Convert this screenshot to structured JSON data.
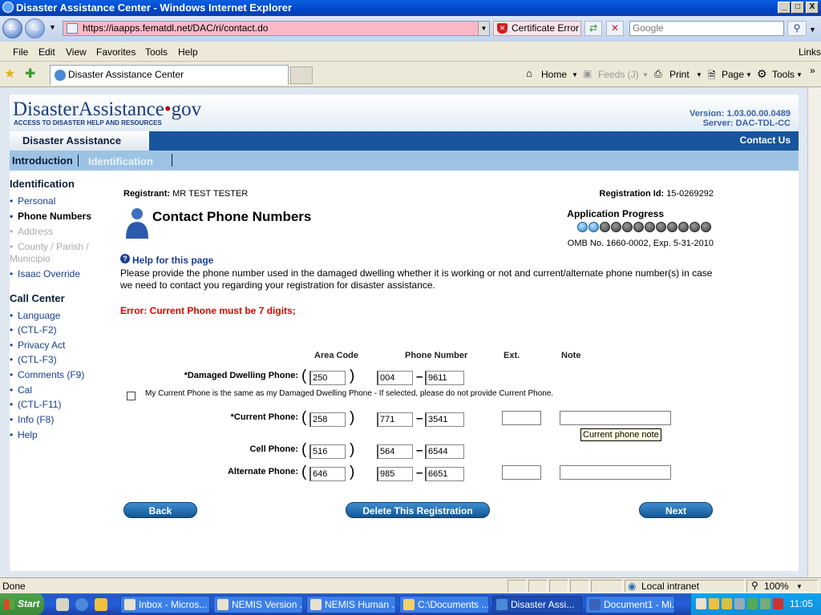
{
  "window": {
    "title": "Disaster Assistance Center - Windows Internet Explorer"
  },
  "toolbar": {
    "url": "https://iaapps.fematdl.net/DAC/ri/contact.do",
    "cert_error": "Certificate Error",
    "search_placeholder": "Google"
  },
  "menu": [
    "File",
    "Edit",
    "View",
    "Favorites",
    "Tools",
    "Help"
  ],
  "links_label": "Links",
  "tab": {
    "label": "Disaster Assistance Center"
  },
  "commands": {
    "home": "Home",
    "feeds": "Feeds (J)",
    "print": "Print",
    "page": "Page",
    "tools": "Tools"
  },
  "site": {
    "logo_main": "DisasterAssistance",
    "logo_dot": "•",
    "logo_tld": "gov",
    "tagline": "ACCESS TO DISASTER HELP AND RESOURCES",
    "version": "Version: 1.03.00.00.0489",
    "server": "Server: DAC-TDL-CC",
    "brand": "Disaster Assistance",
    "contact": "Contact Us",
    "crumb1": "Introduction",
    "crumb2": "Identification"
  },
  "sidebar": {
    "heading1": "Identification",
    "items1": [
      "Personal",
      "Phone Numbers",
      "Address",
      "County / Parish /",
      "Municipio",
      "Isaac Override"
    ],
    "heading2": "Call Center",
    "items2": [
      "Language",
      "(CTL-F2)",
      "Privacy Act",
      "(CTL-F3)",
      "Comments (F9)",
      "Cal",
      "(CTL-F11)",
      "Info (F8)",
      "Help"
    ]
  },
  "form": {
    "registrant_label": "Registrant:",
    "registrant_value": "MR TEST TESTER",
    "regid_label": "Registration Id:",
    "regid_value": "15-0269292",
    "title": "Contact Phone Numbers",
    "progress_title": "Application Progress",
    "progress": {
      "completed": 2,
      "total": 12
    },
    "omb": "OMB No. 1660-0002, Exp. 5-31-2010",
    "help_link": "Help for this page",
    "instructions": "Please provide the phone number used in the damaged dwelling whether it is working or not and current/alternate phone number(s) in case we need to contact you regarding your registration for disaster assistance.",
    "error": "Error: Current Phone must be 7 digits;",
    "col_area": "Area Code",
    "col_phone": "Phone Number",
    "col_ext": "Ext.",
    "col_note": "Note",
    "damaged": {
      "label": "*Damaged Dwelling Phone:",
      "area": "250",
      "prefix": "004",
      "line": "9611"
    },
    "same_checkbox": "My Current Phone is the same as my Damaged Dwelling Phone - If selected, please do not provide Current Phone.",
    "current": {
      "label": "*Current Phone:",
      "area": "258",
      "prefix": "771",
      "line": "3541",
      "ext": "",
      "note": ""
    },
    "cell": {
      "label": "Cell Phone:",
      "area": "516",
      "prefix": "564",
      "line": "6544"
    },
    "alternate": {
      "label": "Alternate Phone:",
      "area": "646",
      "prefix": "985",
      "line": "6651",
      "ext": "",
      "note": ""
    },
    "tooltip": "Current phone note",
    "paren_open": "(",
    "paren_close": ")",
    "dash": "–",
    "back": "Back",
    "delete": "Delete This Registration",
    "next": "Next"
  },
  "status": {
    "text": "Done",
    "zone": "Local intranet",
    "zoom": "100%"
  },
  "taskbar": {
    "start": "Start",
    "items": [
      "Inbox - Micros...",
      "NEMIS Version ...",
      "NEMIS Human ...",
      "C:\\Documents ...",
      "Disaster Assi...",
      "Document1 - Mi..."
    ],
    "clock": "11:05"
  },
  "colors": {
    "accent": "#18559c",
    "error": "#e00000",
    "link": "#173e8f"
  }
}
